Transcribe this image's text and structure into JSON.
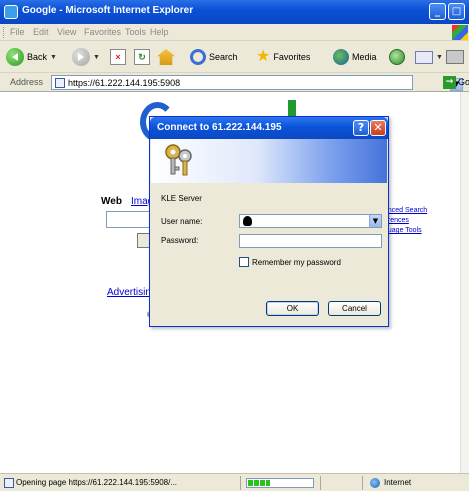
{
  "window": {
    "title": "Google - Microsoft Internet Explorer",
    "minimize_glyph": "_",
    "maximize_glyph": "□"
  },
  "menubar": {
    "items": [
      "File",
      "Edit",
      "View",
      "Favorites",
      "Tools",
      "Help"
    ]
  },
  "toolbar": {
    "back_label": "Back",
    "search_label": "Search",
    "favorites_label": "Favorites",
    "media_label": "Media"
  },
  "addressbar": {
    "label": "Address",
    "url": "https://61.222.144.195:5908",
    "go_label": "Go"
  },
  "page": {
    "web_label": "Web",
    "images_link": "Imag",
    "right_links": [
      "anced Search",
      "erences",
      "guage Tools"
    ],
    "advertising_link": "Advertising",
    "copyright_glyph": "©"
  },
  "dialog": {
    "title": "Connect to 61.222.144.195",
    "help_glyph": "?",
    "close_glyph": "✕",
    "realm": "KLE Server",
    "user_label": "User name:",
    "password_label": "Password:",
    "user_value": "",
    "password_value": "",
    "remember_label": "Remember my password",
    "remember_checked": false,
    "ok_label": "OK",
    "cancel_label": "Cancel"
  },
  "statusbar": {
    "text": "Opening page https://61.222.144.195:5908/...",
    "progress": 0.35,
    "zone": "Internet"
  }
}
